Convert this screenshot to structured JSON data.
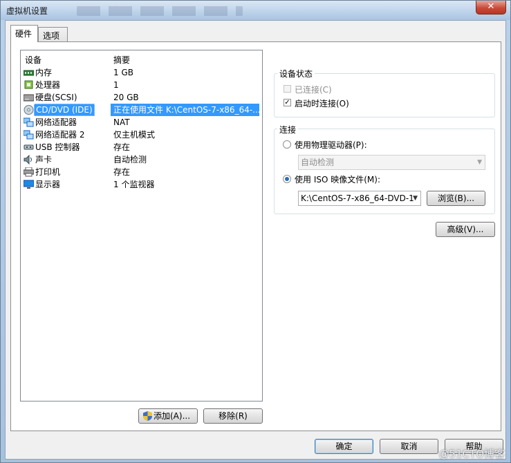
{
  "window": {
    "title": "虚拟机设置",
    "close_label": "✕"
  },
  "tabs": [
    {
      "label": "硬件",
      "active": true
    },
    {
      "label": "选项",
      "active": false
    }
  ],
  "device_list": {
    "headers": {
      "device": "设备",
      "summary": "摘要"
    },
    "rows": [
      {
        "icon": "memory-icon",
        "name": "内存",
        "summary": "1 GB"
      },
      {
        "icon": "processor-icon",
        "name": "处理器",
        "summary": "1"
      },
      {
        "icon": "hard-disk-icon",
        "name": "硬盘(SCSI)",
        "summary": "20 GB"
      },
      {
        "icon": "cd-dvd-icon",
        "name": "CD/DVD (IDE)",
        "summary": "正在使用文件 K:\\CentOS-7-x86_64-...",
        "selected": true
      },
      {
        "icon": "network-adapter-icon",
        "name": "网络适配器",
        "summary": "NAT"
      },
      {
        "icon": "network-adapter-icon",
        "name": "网络适配器 2",
        "summary": "仅主机模式"
      },
      {
        "icon": "usb-icon",
        "name": "USB 控制器",
        "summary": "存在"
      },
      {
        "icon": "sound-card-icon",
        "name": "声卡",
        "summary": "自动检测"
      },
      {
        "icon": "printer-icon",
        "name": "打印机",
        "summary": "存在"
      },
      {
        "icon": "display-icon",
        "name": "显示器",
        "summary": "1 个监视器"
      }
    ]
  },
  "list_buttons": {
    "add": "添加(A)...",
    "remove": "移除(R)"
  },
  "device_status": {
    "title": "设备状态",
    "connected_label": "已连接(C)",
    "connected_checked": false,
    "connect_at_power_on_label": "启动时连接(O)",
    "connect_at_power_on_checked": true
  },
  "connection": {
    "title": "连接",
    "physical_drive_label": "使用物理驱动器(P):",
    "physical_drive_value": "自动检测",
    "iso_label": "使用 ISO 映像文件(M):",
    "iso_value": "K:\\CentOS-7-x86_64-DVD-1",
    "browse_label": "浏览(B)...",
    "selected": "iso"
  },
  "advanced_label": "高级(V)...",
  "footer": {
    "ok": "确定",
    "cancel": "取消",
    "help": "帮助"
  },
  "watermark": "@51CTO博客",
  "colors": {
    "selection": "#3399ff",
    "title_bar": "#bcd2ea"
  }
}
